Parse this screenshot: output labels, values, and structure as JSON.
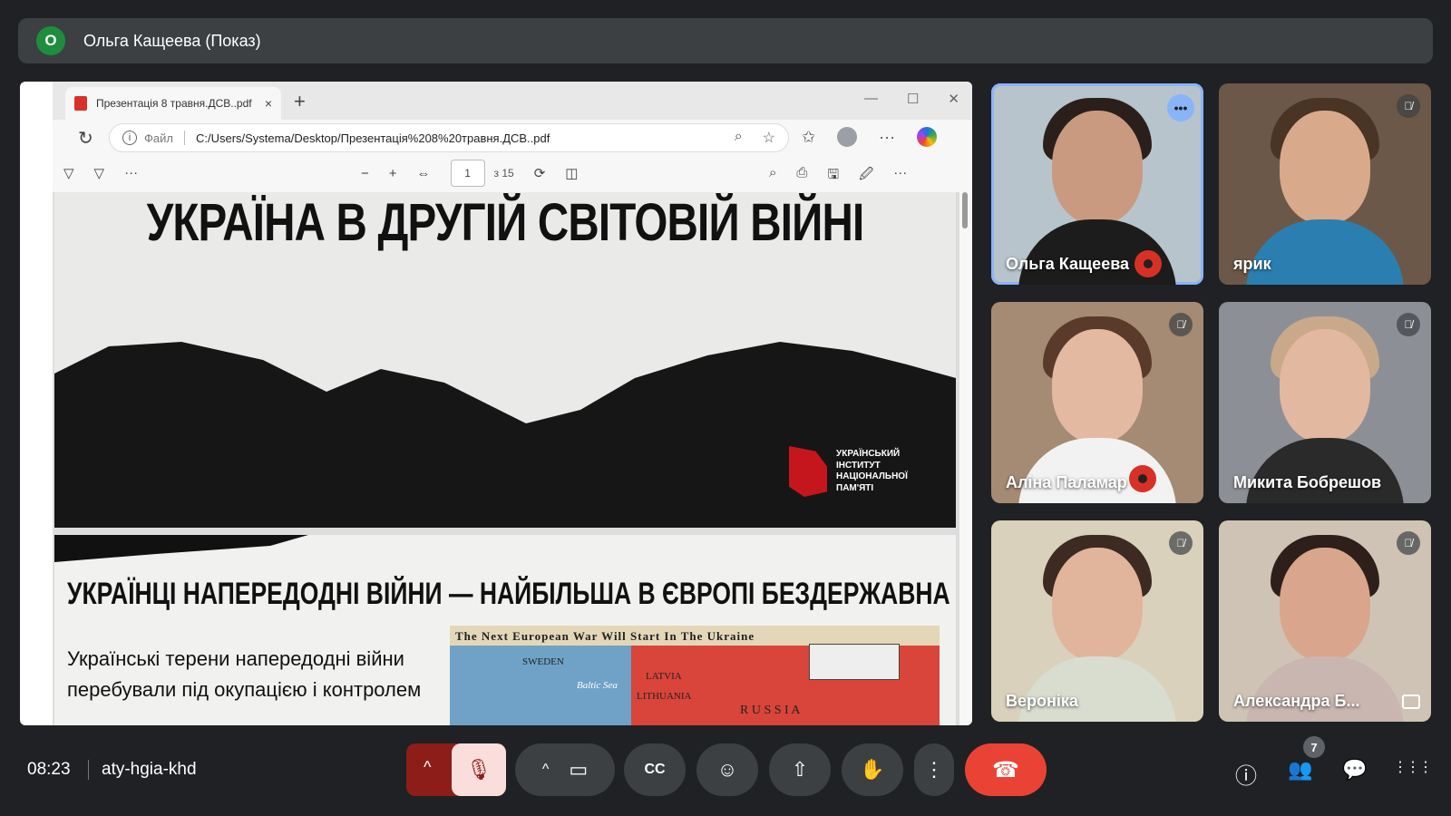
{
  "presenter": {
    "avatar_letter": "О",
    "name": "Ольга Кащеева (Показ)"
  },
  "browser": {
    "tab_title": "Презентація 8 травня.ДСВ..pdf",
    "tab_close": "×",
    "new_tab": "+",
    "win_minimize": "—",
    "win_maximize": "☐",
    "win_close": "✕",
    "reload": "↻",
    "info": "i",
    "file_label": "Файл",
    "url": "C:/Users/Systema/Desktop/Презентація%208%20травня.ДСВ..pdf",
    "zoom_glyph": "⌕",
    "star_glyph": "☆",
    "favorites_glyph": "✩",
    "more_glyph": "···"
  },
  "pdf_toolbar": {
    "draw_glyph": "▽",
    "highlight_glyph": "▽",
    "more_glyph": "···",
    "zoom_out": "−",
    "zoom_in": "+",
    "fit_glyph": "⇔",
    "page_current": "1",
    "page_total": "з 15",
    "rotate_glyph": "⟳",
    "view_glyph": "◫",
    "search_glyph": "⌕",
    "print_glyph": "⎙",
    "save_glyph": "🖫",
    "save_as_glyph": "🖉"
  },
  "slide1": {
    "title": "УКРАЇНА В ДРУГІЙ СВІТОВІЙ ВІЙНІ",
    "logo_text": "УКРАЇНСЬКИЙ ІНСТИТУТ НАЦІОНАЛЬНОЇ ПАМ'ЯТІ"
  },
  "slide2": {
    "title": "УКРАЇНЦІ НАПЕРЕДОДНІ ВІЙНИ — НАЙБІЛЬША В ЄВРОПІ БЕЗДЕРЖАВНА НАЦІЯ",
    "text": "Українські терени напередодні війни перебували під окупацією і контролем",
    "map_title": "The Next European War Will Start In The Ukraine",
    "map_sweden": "SWEDEN",
    "map_baltic": "Baltic Sea",
    "map_latvia": "LATVIA",
    "map_lithuania": "LITHUANIA",
    "map_russia": "R U S S I A"
  },
  "participants": [
    {
      "name": "Ольга Кащеева",
      "skin": "#c99a80",
      "hair": "#2b1f1c",
      "shirt": "#1c1c1c",
      "bg": "#b7c4cc"
    },
    {
      "name": "ярик",
      "skin": "#d9a98c",
      "hair": "#4a3424",
      "shirt": "#2a7fb0",
      "bg": "#6b5848"
    },
    {
      "name": "Аліна Паламар",
      "skin": "#e3b9a2",
      "hair": "#5a3a2a",
      "shirt": "#f2f2f2",
      "bg": "#a58a74"
    },
    {
      "name": "Микита Бобрешов",
      "skin": "#e2b8a0",
      "hair": "#c9a98a",
      "shirt": "#2a2a2a",
      "bg": "#8d8f96"
    },
    {
      "name": "Вероніка",
      "skin": "#e1b59b",
      "hair": "#3d2a22",
      "shirt": "#d8ddd0",
      "bg": "#d9d1bc"
    },
    {
      "name": "Александра Б...",
      "skin": "#d9a68d",
      "hair": "#2e1f1a",
      "shirt": "#c9b6b0",
      "bg": "#cfc3b6"
    }
  ],
  "icons": {
    "mic_off": "🎙̸",
    "more_options": "•••"
  },
  "bottom_bar": {
    "time": "08:23",
    "meeting_code": "aty-hgia-khd",
    "chevron_up": "^",
    "mic_glyph": "🎙",
    "camera_glyph": "▭",
    "captions_glyph": "CC",
    "emoji_glyph": "☺",
    "present_glyph": "⇧",
    "hand_glyph": "✋",
    "more_glyph": "⋮",
    "end_call_glyph": "☎",
    "info_glyph": "ⓘ",
    "people_glyph": "👥",
    "people_count": "7",
    "chat_glyph": "💬",
    "activities_glyph": "⋮⋮⋮"
  }
}
